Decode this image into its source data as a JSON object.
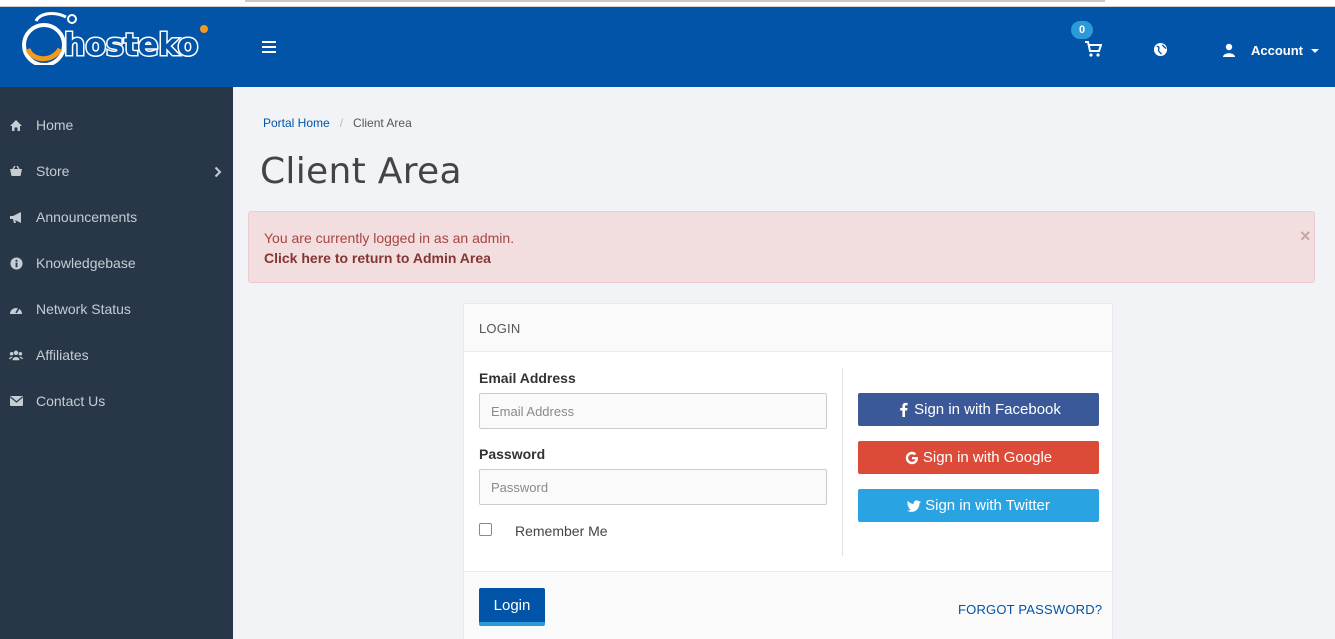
{
  "header": {
    "brand": "hosteko",
    "cart_count": "0",
    "account_label": "Account"
  },
  "sidebar": {
    "items": [
      {
        "label": "Home",
        "icon": "home-icon"
      },
      {
        "label": "Store",
        "icon": "basket-icon"
      },
      {
        "label": "Announcements",
        "icon": "bullhorn-icon"
      },
      {
        "label": "Knowledgebase",
        "icon": "info-icon"
      },
      {
        "label": "Network Status",
        "icon": "dashboard-icon"
      },
      {
        "label": "Affiliates",
        "icon": "users-icon"
      },
      {
        "label": "Contact Us",
        "icon": "envelope-icon"
      }
    ]
  },
  "breadcrumb": {
    "home": "Portal Home",
    "current": "Client Area"
  },
  "page_title": "Client Area",
  "alert": {
    "message": "You are currently logged in as an admin.",
    "link": "Click here to return to Admin Area",
    "close": "×"
  },
  "login_panel": {
    "title": "LOGIN",
    "email_label": "Email Address",
    "email_placeholder": "Email Address",
    "password_label": "Password",
    "password_placeholder": "Password",
    "remember_label": "Remember Me",
    "facebook_label": "Sign in with Facebook",
    "google_label": "Sign in with Google",
    "twitter_label": "Sign in with Twitter",
    "login_button": "Login",
    "forgot_link": "FORGOT PASSWORD?"
  },
  "colors": {
    "header": "#0154a7",
    "sidebar": "#283747",
    "facebook": "#3b5998",
    "google": "#dc4a38",
    "twitter": "#2aa3e3",
    "alert_bg": "#f2dede"
  }
}
